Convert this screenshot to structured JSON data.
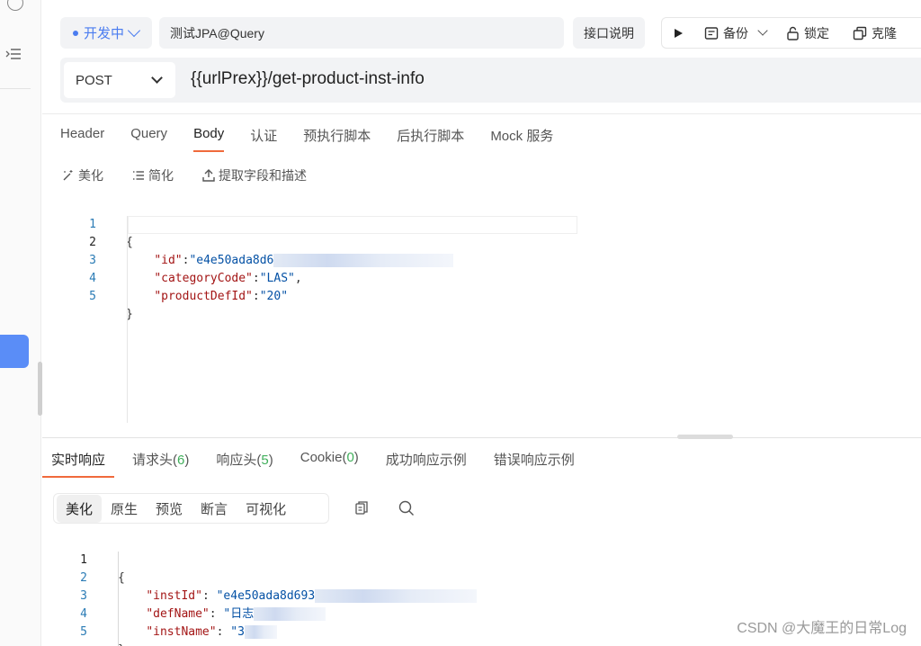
{
  "colors": {
    "accent_blue": "#4a7cf0",
    "tab_underline": "#f06a3c",
    "count_green": "#3fae5a",
    "sidebar_active": "#5a8df7"
  },
  "header": {
    "status_label": "开发中",
    "api_name": "测试JPA@Query",
    "doc_button": "接口说明",
    "actions": {
      "run_icon": "play-icon",
      "backup": "备份",
      "lock": "锁定",
      "clone": "克隆"
    }
  },
  "request": {
    "method": "POST",
    "url": "{{urlPrex}}/get-product-inst-info",
    "tabs": [
      "Header",
      "Query",
      "Body",
      "认证",
      "预执行脚本",
      "后执行脚本",
      "Mock 服务"
    ],
    "active_tab": "Body",
    "tools": [
      "美化",
      "简化",
      "提取字段和描述"
    ],
    "body_lines": [
      {
        "n": "1",
        "open": "{"
      },
      {
        "n": "2",
        "key": "\"id\"",
        "val": "\"e4e50ada8d6"
      },
      {
        "n": "3",
        "key": "\"categoryCode\"",
        "val": "\"LAS\""
      },
      {
        "n": "4",
        "key": "\"productDefId\"",
        "val": "\"20\""
      },
      {
        "n": "5",
        "open": "}"
      }
    ]
  },
  "response": {
    "tabs": [
      {
        "label": "实时响应"
      },
      {
        "label": "请求头",
        "count": "6"
      },
      {
        "label": "响应头",
        "count": "5"
      },
      {
        "label": "Cookie",
        "count": "0"
      },
      {
        "label": "成功响应示例"
      },
      {
        "label": "错误响应示例"
      }
    ],
    "view_modes": [
      "美化",
      "原生",
      "预览",
      "断言",
      "可视化"
    ],
    "body_lines": [
      {
        "n": "1",
        "open": "{"
      },
      {
        "n": "2",
        "key": "\"instId\"",
        "val": "\"e4e50ada8d693"
      },
      {
        "n": "3",
        "key": "\"defName\"",
        "val": "\"日志"
      },
      {
        "n": "4",
        "key": "\"instName\"",
        "val": "\"3"
      },
      {
        "n": "5",
        "open": "}"
      }
    ]
  },
  "watermark": "CSDN @大魔王的日常Log"
}
